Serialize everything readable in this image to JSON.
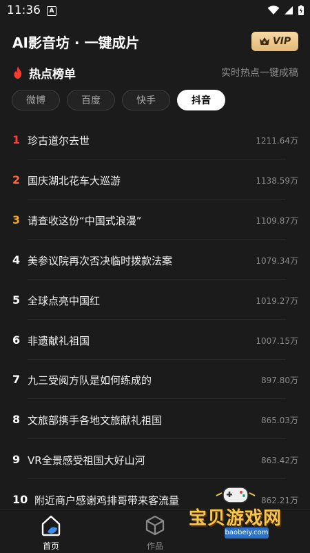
{
  "status": {
    "time": "11:36",
    "a_badge": "A"
  },
  "header": {
    "title": "AI影音坊 · 一键成片",
    "vip_label": "VIP"
  },
  "hot": {
    "title": "热点榜单",
    "subtitle": "实时热点一键成稿"
  },
  "tabs": [
    {
      "label": "微博",
      "active": false
    },
    {
      "label": "百度",
      "active": false
    },
    {
      "label": "快手",
      "active": false
    },
    {
      "label": "抖音",
      "active": true
    }
  ],
  "list": [
    {
      "rank": "1",
      "title": "珍古道尔去世",
      "count": "1211.64万"
    },
    {
      "rank": "2",
      "title": "国庆湖北花车大巡游",
      "count": "1138.59万"
    },
    {
      "rank": "3",
      "title": "请查收这份“中国式浪漫”",
      "count": "1109.87万"
    },
    {
      "rank": "4",
      "title": "美参议院再次否决临时拨款法案",
      "count": "1079.34万"
    },
    {
      "rank": "5",
      "title": "全球点亮中国红",
      "count": "1019.27万"
    },
    {
      "rank": "6",
      "title": "非遗献礼祖国",
      "count": "1007.15万"
    },
    {
      "rank": "7",
      "title": "九三受阅方队是如何练成的",
      "count": "897.80万"
    },
    {
      "rank": "8",
      "title": "文旅部携手各地文旅献礼祖国",
      "count": "865.03万"
    },
    {
      "rank": "9",
      "title": "VR全景感受祖国大好山河",
      "count": "863.42万"
    },
    {
      "rank": "10",
      "title": "附近商户感谢鸡排哥带来客流量",
      "count": "862.21万"
    }
  ],
  "nav": {
    "home": "首页",
    "works": "作品"
  },
  "watermark": {
    "text": "宝贝游戏网",
    "url": "baobeiy.com"
  },
  "colors": {
    "rank1": "#ff3b3b",
    "rank2": "#ff6a3d",
    "rank3": "#f5a524",
    "vip": "#e2b977",
    "background": "#1b1b1b"
  }
}
